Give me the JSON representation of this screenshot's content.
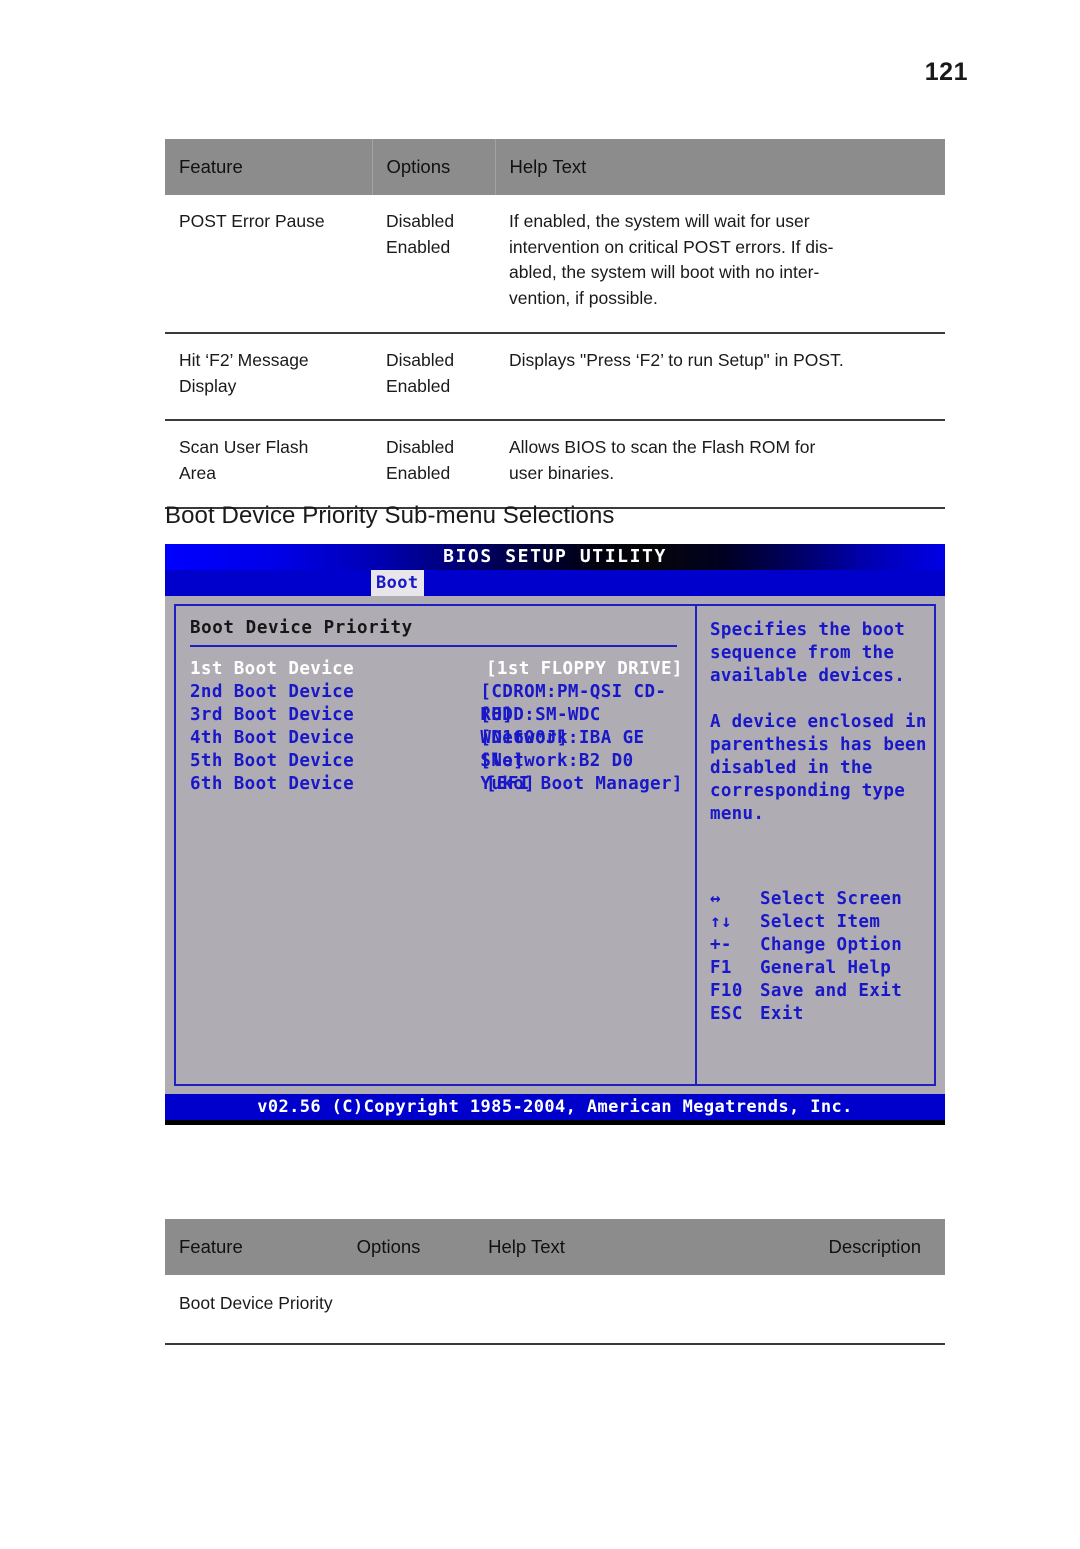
{
  "page": {
    "number": "121"
  },
  "table_top": {
    "headers": [
      "Feature",
      "Options",
      "Help Text"
    ],
    "rows": [
      {
        "feature": [
          "POST Error Pause"
        ],
        "options": [
          "Disabled",
          "Enabled"
        ],
        "help": [
          "If enabled, the system will wait for user",
          "intervention on critical POST errors. If dis-",
          "abled, the system will boot with no inter-",
          "vention, if possible."
        ]
      },
      {
        "feature": [
          "Hit ‘F2’ Message",
          "Display"
        ],
        "options": [
          "Disabled",
          "Enabled"
        ],
        "help": [
          "Displays \"Press ‘F2’ to run Setup\" in POST."
        ]
      },
      {
        "feature": [
          "Scan User Flash",
          "Area"
        ],
        "options": [
          "Disabled",
          "Enabled"
        ],
        "help": [
          "Allows BIOS to scan the Flash ROM for",
          "user binaries."
        ]
      }
    ]
  },
  "section": {
    "heading": "Boot Device Priority Sub-menu Selections"
  },
  "bios": {
    "title": "BIOS SETUP UTILITY",
    "active_tab": "Boot",
    "panel_title": "Boot Device Priority",
    "devices": [
      {
        "label": "1st Boot Device",
        "value": "[1st FLOPPY DRIVE]",
        "selected": true
      },
      {
        "label": "2nd Boot Device",
        "value": "[CDROM:PM-QSI CD-RO]",
        "selected": false
      },
      {
        "label": "3rd Boot Device",
        "value": "[HDD:SM-WDC WD1600J]",
        "selected": false
      },
      {
        "label": "4th Boot Device",
        "value": "[Network:IBA GE Slo]",
        "selected": false
      },
      {
        "label": "5th Boot Device",
        "value": "[Network:B2 D0 Yuko]",
        "selected": false
      },
      {
        "label": "6th Boot Device",
        "value": "[EFI Boot Manager]",
        "selected": false
      }
    ],
    "help": [
      [
        "Specifies the boot",
        "sequence from the",
        "available devices."
      ],
      [
        "A device enclosed in",
        "parenthesis has been",
        "disabled in the",
        "corresponding type",
        "menu."
      ]
    ],
    "keys": [
      {
        "symbol": "↔",
        "description": "Select Screen"
      },
      {
        "symbol": "↑↓",
        "description": "Select Item"
      },
      {
        "symbol": "+-",
        "description": "Change Option"
      },
      {
        "symbol": "F1",
        "description": "General Help"
      },
      {
        "symbol": "F10",
        "description": "Save and Exit"
      },
      {
        "symbol": "ESC",
        "description": "Exit"
      }
    ],
    "footer": "v02.56 (C)Copyright 1985-2004, American Megatrends, Inc."
  },
  "table_bottom": {
    "headers": [
      "Feature",
      "Options",
      "Help Text",
      "Description"
    ],
    "rows": [
      {
        "feature": [
          "Boot Device Priority"
        ],
        "options": [],
        "help": [],
        "description": []
      }
    ]
  }
}
